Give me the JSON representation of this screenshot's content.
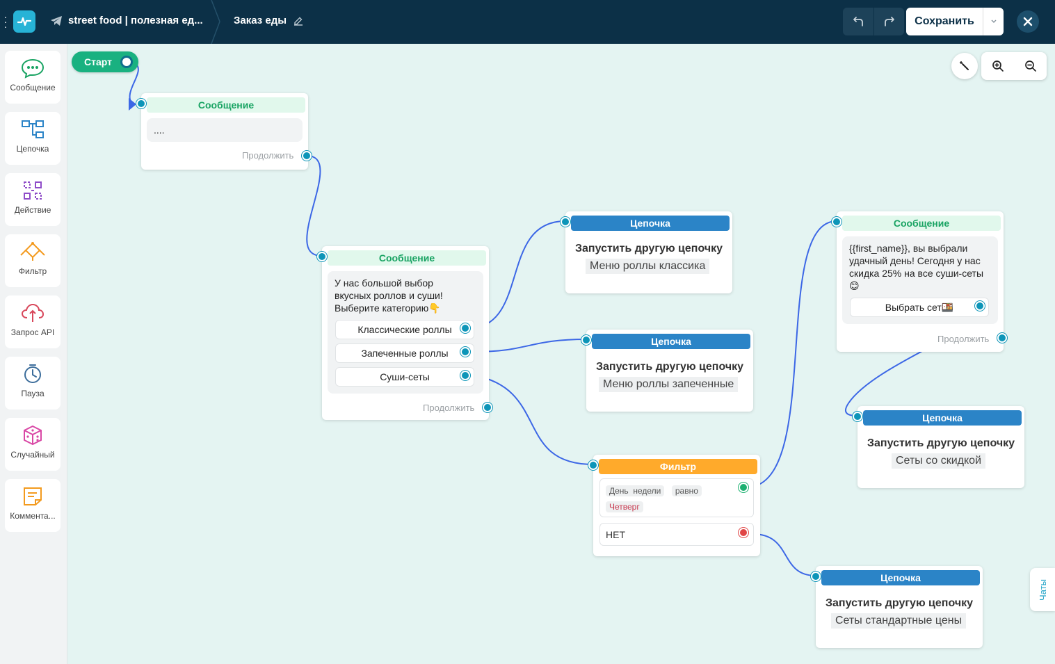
{
  "topbar": {
    "channel_name": "street food | полезная ед...",
    "flow_title": "Заказ еды",
    "save_label": "Сохранить"
  },
  "sidebar": {
    "items": [
      {
        "label": "Сообщение",
        "icon": "message-icon"
      },
      {
        "label": "Цепочка",
        "icon": "chain-icon"
      },
      {
        "label": "Действие",
        "icon": "action-icon"
      },
      {
        "label": "Фильтр",
        "icon": "filter-icon"
      },
      {
        "label": "Запрос API",
        "icon": "api-icon"
      },
      {
        "label": "Пауза",
        "icon": "pause-icon"
      },
      {
        "label": "Случайный",
        "icon": "random-icon"
      },
      {
        "label": "Коммента...",
        "icon": "comment-icon"
      }
    ]
  },
  "canvas": {
    "start_label": "Старт",
    "chats_tab": "Чаты",
    "nodes": {
      "msg1": {
        "header": "Сообщение",
        "text": "....",
        "continue": "Продолжить"
      },
      "msg2": {
        "header": "Сообщение",
        "text_line1": "У нас большой выбор",
        "text_line2": "вкусных роллов и суши!",
        "text_line3": "Выберите категорию👇",
        "buttons": [
          "Классические роллы",
          "Запеченные роллы",
          "Суши-сеты"
        ],
        "continue": "Продолжить"
      },
      "chain1": {
        "header": "Цепочка",
        "title": "Запустить другую цепочку",
        "name": "Меню роллы классика"
      },
      "chain2": {
        "header": "Цепочка",
        "title": "Запустить другую цепочку",
        "name": "Меню роллы запеченные"
      },
      "filter": {
        "header": "Фильтр",
        "cond_field1": "День",
        "cond_field2": "недели",
        "cond_op": "равно",
        "cond_value": "Четверг",
        "else_label": "НЕТ"
      },
      "msg3": {
        "header": "Сообщение",
        "text_line1": "{{first_name}}, вы выбрали",
        "text_line2": "удачный день! Сегодня у нас",
        "text_line3": "скидка 25% на все суши-сеты",
        "text_emoji": "😊",
        "button": "Выбрать сет🍱",
        "continue": "Продолжить"
      },
      "chain3": {
        "header": "Цепочка",
        "title": "Запустить другую цепочку",
        "name": "Сеты со скидкой"
      },
      "chain4": {
        "header": "Цепочка",
        "title": "Запустить другую цепочку",
        "name": "Сеты стандартные цены"
      }
    }
  },
  "colors": {
    "topbar": "#0c3047",
    "canvas": "#e4f4f2",
    "accent": "#27b3d6",
    "message_header": "#18a362",
    "chain_header": "#2b84c7",
    "filter_header": "#ffaa2b",
    "edge": "#3c67e6"
  }
}
